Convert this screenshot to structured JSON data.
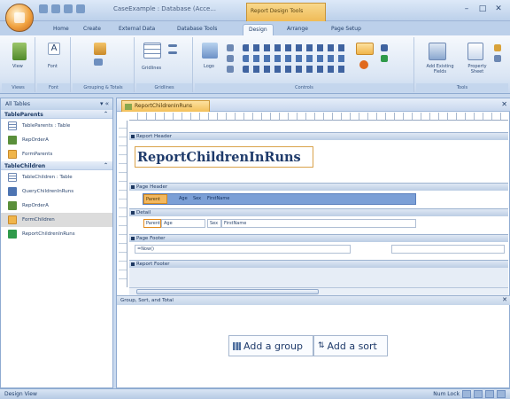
{
  "window": {
    "title": "CaseExample : Database (Acce...",
    "context_tab": "Report Design Tools"
  },
  "ribbon_tabs": [
    "Home",
    "Create",
    "External Data",
    "Database Tools",
    "Design",
    "Arrange",
    "Page Setup"
  ],
  "ribbon_groups": {
    "views": "Views",
    "font": "Font",
    "grouping": "Grouping & Totals",
    "gridlines": "Gridlines",
    "controls": "Controls",
    "tools": "Tools"
  },
  "ribbon_buttons": {
    "view": "View",
    "font": "Font",
    "gridlines": "Gridlines",
    "logo": "Logo",
    "add_existing_fields": "Add Existing Fields",
    "property_sheet": "Property Sheet"
  },
  "nav": {
    "header": "All Tables",
    "groups": [
      {
        "name": "TableParents",
        "items": [
          "TableParents : Table",
          "RepOrderA",
          "FormParents"
        ]
      },
      {
        "name": "TableChildren",
        "items": [
          "TableChildren : Table",
          "QueryChildrenInRuns",
          "RepOrderA",
          "FormChildren",
          "ReportChildrenInRuns"
        ]
      }
    ],
    "selected_item": "FormChildren"
  },
  "document": {
    "tab_label": "ReportChildrenInRuns",
    "sections": {
      "report_header": "Report Header",
      "page_header": "Page Header",
      "detail": "Detail",
      "page_footer": "Page Footer",
      "report_footer": "Report Footer"
    },
    "report_title": "ReportChildrenInRuns",
    "page_header_fields": [
      "Parent",
      "Age",
      "Sex",
      "FirstName"
    ],
    "detail_fields": [
      "Parent",
      "Age",
      "Sex",
      "FirstName"
    ],
    "page_footer_fields": [
      "=Now()",
      ""
    ]
  },
  "grouping_pane": {
    "title": "Group, Sort, and Total",
    "add_group": "Add a group",
    "add_sort": "Add a sort"
  },
  "status": {
    "left": "Design View",
    "right": "Num Lock"
  }
}
